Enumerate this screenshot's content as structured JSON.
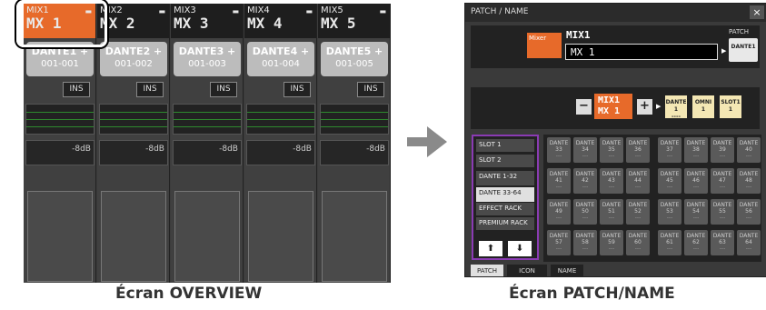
{
  "overview": {
    "channels": [
      {
        "id": "MIX1",
        "name": "MX 1",
        "patch": "DANTE1 +",
        "range": "001-001",
        "ins": "INS",
        "level": "-8dB",
        "selected": true
      },
      {
        "id": "MIX2",
        "name": "MX 2",
        "patch": "DANTE2 +",
        "range": "001-002",
        "ins": "INS",
        "level": "-8dB",
        "selected": false
      },
      {
        "id": "MIX3",
        "name": "MX 3",
        "patch": "DANTE3 +",
        "range": "001-003",
        "ins": "INS",
        "level": "-8dB",
        "selected": false
      },
      {
        "id": "MIX4",
        "name": "MX 4",
        "patch": "DANTE4 +",
        "range": "001-004",
        "ins": "INS",
        "level": "-8dB",
        "selected": false
      },
      {
        "id": "MIX5",
        "name": "MX 5",
        "patch": "DANTE5 +",
        "range": "001-005",
        "ins": "INS",
        "level": "-8dB",
        "selected": false
      }
    ],
    "caption": "Écran OVERVIEW"
  },
  "patch_name": {
    "title": "PATCH / NAME",
    "close": "×",
    "type_button": "Mixer",
    "channel_id": "MIX1",
    "name_value": "MX  1",
    "patch_label": "PATCH",
    "patch_value": "DANTE1",
    "selector": {
      "minus": "−",
      "plus": "+",
      "id": "MIX1",
      "name": "MX  1"
    },
    "input_buttons": [
      {
        "l1": "DANTE",
        "l2": "1",
        "l3": "----"
      },
      {
        "l1": "OMNI",
        "l2": "1",
        "l3": ""
      },
      {
        "l1": "SLOT1",
        "l2": "1",
        "l3": ""
      }
    ],
    "list_items": [
      "SLOT 1",
      "SLOT 2",
      "DANTE 1-32",
      "DANTE 33-64",
      "EFFECT RACK",
      "PREMIUM RACK"
    ],
    "list_selected_index": 3,
    "scroll_up": "⬆",
    "scroll_down": "⬇",
    "grid": [
      [
        "33",
        "34",
        "35",
        "36",
        "37",
        "38",
        "39",
        "40"
      ],
      [
        "41",
        "42",
        "43",
        "44",
        "45",
        "46",
        "47",
        "48"
      ],
      [
        "49",
        "50",
        "51",
        "52",
        "53",
        "54",
        "55",
        "56"
      ],
      [
        "57",
        "58",
        "59",
        "60",
        "61",
        "62",
        "63",
        "64"
      ]
    ],
    "grid_label": "DANTE",
    "tabs": [
      "PATCH",
      "ICON",
      "NAME"
    ],
    "active_tab": 0,
    "caption": "Écran PATCH/NAME"
  }
}
